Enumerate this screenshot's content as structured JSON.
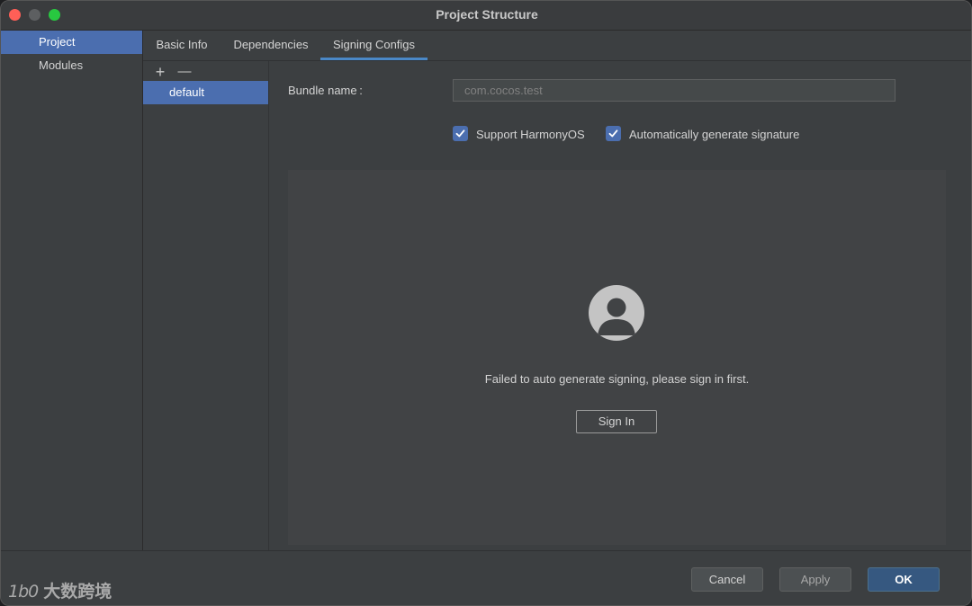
{
  "window": {
    "title": "Project Structure"
  },
  "sidebar": {
    "items": [
      {
        "label": "Project",
        "selected": true
      },
      {
        "label": "Modules",
        "selected": false
      }
    ]
  },
  "tabs": [
    {
      "label": "Basic Info",
      "active": false
    },
    {
      "label": "Dependencies",
      "active": false
    },
    {
      "label": "Signing Configs",
      "active": true
    }
  ],
  "configs": {
    "add_icon": "plus-icon",
    "remove_icon": "minus-icon",
    "add_glyph": "+",
    "remove_glyph": "—",
    "items": [
      {
        "label": "default",
        "selected": true
      }
    ]
  },
  "form": {
    "bundle_label": "Bundle name :",
    "bundle_value": "com.cocos.test",
    "support_harmony": {
      "label": "Support HarmonyOS",
      "checked": true
    },
    "auto_sign": {
      "label": "Automatically generate signature",
      "checked": true
    }
  },
  "signin_panel": {
    "avatar_icon": "user-avatar-icon",
    "message": "Failed to auto generate signing, please sign in first.",
    "button": "Sign In"
  },
  "footer": {
    "cancel": "Cancel",
    "apply": "Apply",
    "ok": "OK"
  },
  "watermark": {
    "logo": "1b0",
    "text": "大数跨境"
  },
  "colors": {
    "accent": "#4b6eaf",
    "tab_underline": "#4a88c7",
    "ok_button": "#365880"
  }
}
